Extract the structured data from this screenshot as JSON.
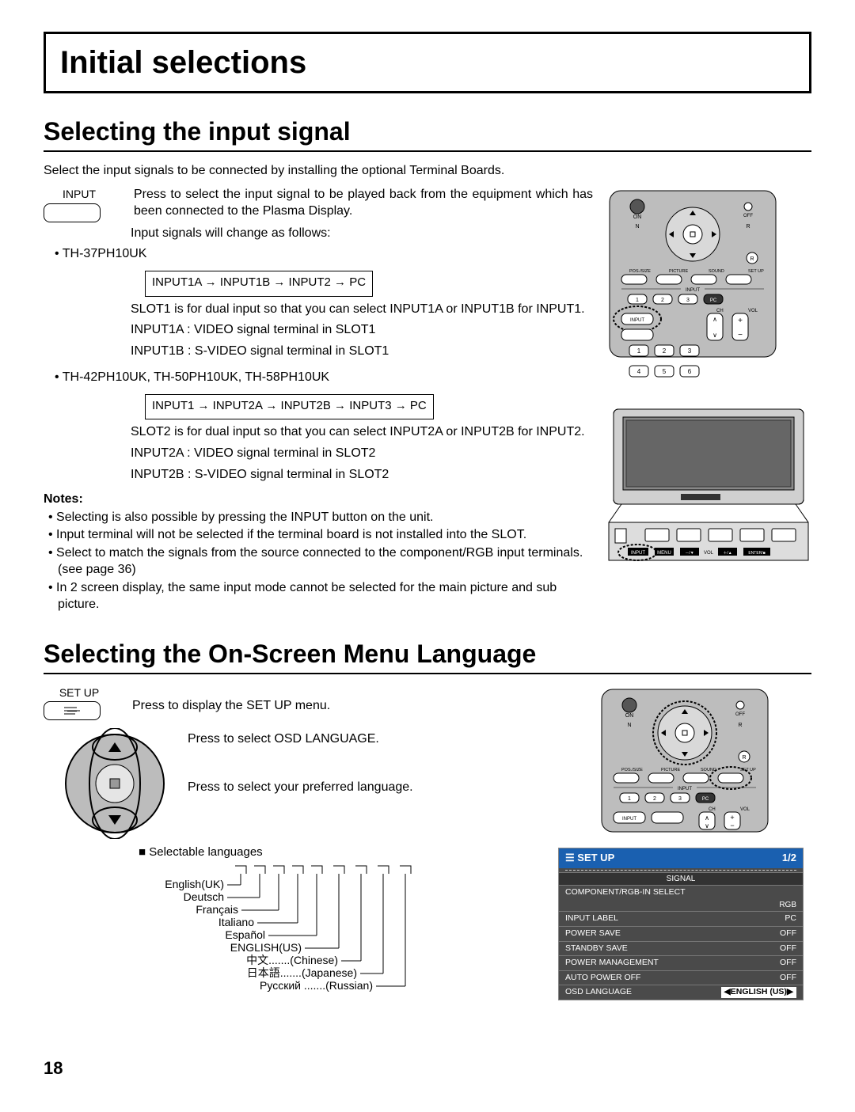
{
  "title": "Initial selections",
  "section1": {
    "heading": "Selecting the input signal",
    "intro": "Select the input signals to be connected by installing the optional Terminal Boards.",
    "input_label": "INPUT",
    "input_desc": "Press to select the input signal to be played back from the equipment which has been connected to the Plasma Display.",
    "change_intro": "Input signals will change as follows:",
    "model1": "• TH-37PH10UK",
    "cycle1": "INPUT1A → INPUT1B → INPUT2 → PC",
    "slot1_desc": "SLOT1 is for dual input so that you can select INPUT1A or INPUT1B for INPUT1.",
    "slot1_a": "INPUT1A :  VIDEO signal terminal in SLOT1",
    "slot1_b": "INPUT1B :  S-VIDEO signal terminal in SLOT1",
    "model2": "• TH-42PH10UK, TH-50PH10UK, TH-58PH10UK",
    "cycle2": "INPUT1 → INPUT2A → INPUT2B → INPUT3 → PC",
    "slot2_desc": "SLOT2 is for dual input so that you can select INPUT2A or INPUT2B for INPUT2.",
    "slot2_a": "INPUT2A :  VIDEO signal terminal in SLOT2",
    "slot2_b": "INPUT2B :  S-VIDEO signal terminal in SLOT2",
    "notes_h": "Notes:",
    "notes": [
      "Selecting is also possible by pressing the INPUT button on the unit.",
      "Input terminal will not be selected if the terminal board is not installed into the SLOT.",
      "Select to match the signals from the source connected to the component/RGB input terminals. (see page 36)",
      "In 2 screen display, the same input mode cannot be selected for the main picture and sub picture."
    ]
  },
  "section2": {
    "heading": "Selecting the On-Screen Menu Language",
    "setup_label": "SET UP",
    "step1": "Press to display the SET UP menu.",
    "step2": "Press to select OSD LANGUAGE.",
    "step3": "Press to select your preferred language.",
    "selectable": "Selectable languages",
    "langs": [
      "English(UK)",
      "Deutsch",
      "Français",
      "Italiano",
      "Español",
      "ENGLISH(US)",
      "中文.......(Chinese)",
      "日本語.......(Japanese)",
      "Русский .......(Russian)"
    ]
  },
  "osd": {
    "title": "SET UP",
    "page": "1/2",
    "signal": "SIGNAL",
    "comp": "COMPONENT/RGB-IN SELECT",
    "rgb": "RGB",
    "rows": [
      {
        "label": "INPUT LABEL",
        "val": "PC"
      },
      {
        "label": "POWER SAVE",
        "val": "OFF"
      },
      {
        "label": "STANDBY SAVE",
        "val": "OFF"
      },
      {
        "label": "POWER MANAGEMENT",
        "val": "OFF"
      },
      {
        "label": "AUTO POWER OFF",
        "val": "OFF"
      }
    ],
    "lang_row": {
      "label": "OSD LANGUAGE",
      "val": "ENGLISH (US)"
    }
  },
  "remote": {
    "on": "ON",
    "off": "OFF",
    "n": "N",
    "r": "R",
    "row_labels": [
      "POS. / SIZE",
      "PICTURE",
      "SOUND",
      "SET UP"
    ],
    "input_h": "INPUT",
    "ch": "CH",
    "vol": "VOL",
    "pc": "PC",
    "input_btn": "INPUT",
    "nums": [
      "1",
      "2",
      "3",
      "4",
      "5",
      "6"
    ]
  },
  "panel": {
    "buttons": [
      "INPUT",
      "MENU",
      "－/▼",
      "VOL",
      "＋/▲",
      "ENTER/■"
    ]
  },
  "page_number": "18"
}
